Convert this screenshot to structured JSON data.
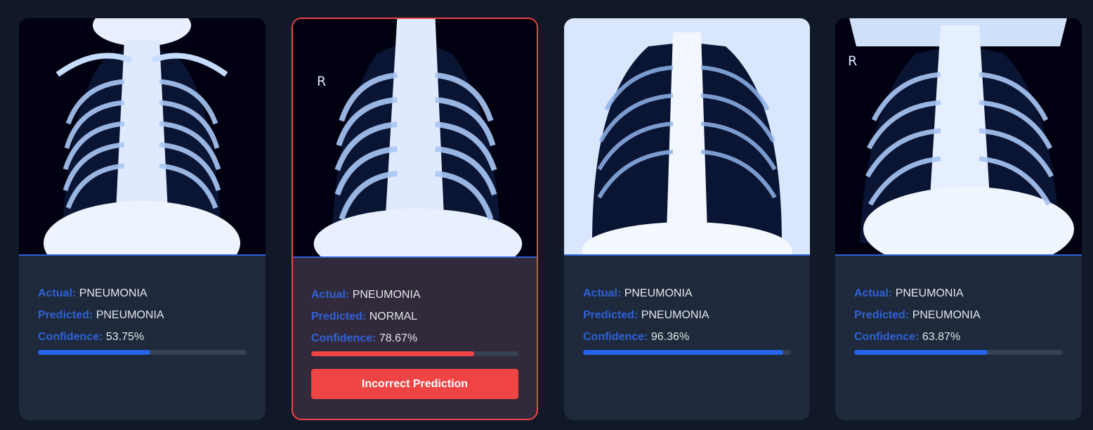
{
  "labels": {
    "actual": "Actual:",
    "predicted": "Predicted:",
    "confidence": "Confidence:"
  },
  "cards": [
    {
      "image_alt": "chest-xray",
      "actual": "PNEUMONIA",
      "predicted": "PNEUMONIA",
      "confidence": "53.75%",
      "confidence_value": 0.5375,
      "correct": true
    },
    {
      "image_alt": "chest-xray",
      "marker": "R",
      "actual": "PNEUMONIA",
      "predicted": "NORMAL",
      "confidence": "78.67%",
      "confidence_value": 0.7867,
      "correct": false,
      "button_label": "Incorrect Prediction"
    },
    {
      "image_alt": "chest-xray",
      "actual": "PNEUMONIA",
      "predicted": "PNEUMONIA",
      "confidence": "96.36%",
      "confidence_value": 0.9636,
      "correct": true
    },
    {
      "image_alt": "chest-xray",
      "marker": "R",
      "actual": "PNEUMONIA",
      "predicted": "PNEUMONIA",
      "confidence": "63.87%",
      "confidence_value": 0.6387,
      "correct": true
    }
  ],
  "colors": {
    "page_bg": "#111827",
    "card_bg": "#1e293b",
    "card_incorrect_bg": "#312a3a",
    "accent_blue": "#2563eb",
    "label_blue": "#2f62d6",
    "error_red": "#ef4444"
  }
}
